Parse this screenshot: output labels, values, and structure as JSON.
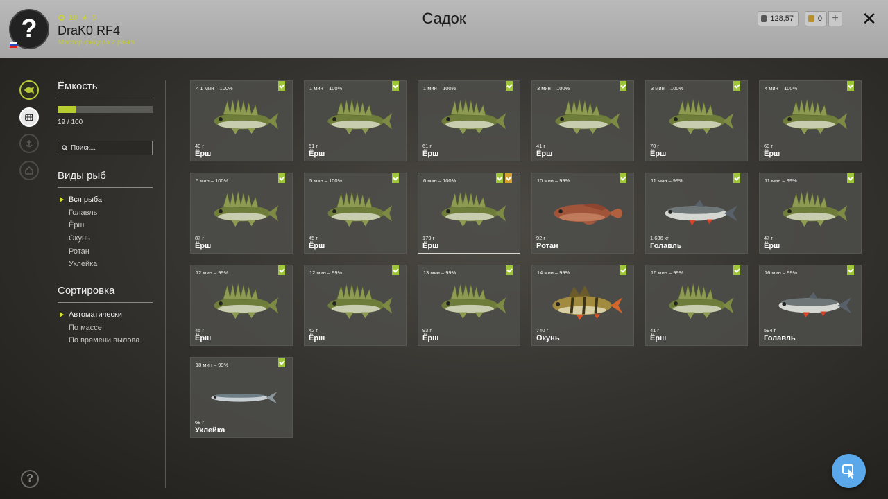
{
  "player": {
    "avatar_glyph": "?",
    "level": "18",
    "stars": "5",
    "name": "DraK0 RF4",
    "rank": "Мастер фидера 2 ранга"
  },
  "title": "Садок",
  "currency": {
    "silver": "128,57",
    "gold": "0"
  },
  "plus_label": "+",
  "close_label": "✕",
  "capacity": {
    "heading": "Ёмкость",
    "used": 19,
    "max": 100,
    "text": "19 / 100"
  },
  "search": {
    "placeholder": "Поиск..."
  },
  "species": {
    "heading": "Виды рыб",
    "items": [
      "Вся рыба",
      "Голавль",
      "Ёрш",
      "Окунь",
      "Ротан",
      "Уклейка"
    ]
  },
  "sort": {
    "heading": "Сортировка",
    "items": [
      "Автоматически",
      "По массе",
      "По времени вылова"
    ]
  },
  "cards": [
    {
      "time": "< 1 мин – 100%",
      "weight": "40 г",
      "name": "Ёрш",
      "fish": "ruffe",
      "gold": false
    },
    {
      "time": "1 мин – 100%",
      "weight": "51 г",
      "name": "Ёрш",
      "fish": "ruffe",
      "gold": false
    },
    {
      "time": "1 мин – 100%",
      "weight": "61 г",
      "name": "Ёрш",
      "fish": "ruffe",
      "gold": false
    },
    {
      "time": "3 мин – 100%",
      "weight": "41 г",
      "name": "Ёрш",
      "fish": "ruffe",
      "gold": false
    },
    {
      "time": "3 мин – 100%",
      "weight": "70 г",
      "name": "Ёрш",
      "fish": "ruffe",
      "gold": false
    },
    {
      "time": "4 мин – 100%",
      "weight": "60 г",
      "name": "Ёрш",
      "fish": "ruffe",
      "gold": false
    },
    {
      "time": "5 мин – 100%",
      "weight": "87 г",
      "name": "Ёрш",
      "fish": "ruffe",
      "gold": false
    },
    {
      "time": "5 мин – 100%",
      "weight": "45 г",
      "name": "Ёрш",
      "fish": "ruffe",
      "gold": false
    },
    {
      "time": "6 мин – 100%",
      "weight": "179 г",
      "name": "Ёрш",
      "fish": "ruffe",
      "gold": true,
      "selected": true
    },
    {
      "time": "10 мин – 99%",
      "weight": "92 г",
      "name": "Ротан",
      "fish": "rotan",
      "gold": false
    },
    {
      "time": "11 мин – 99%",
      "weight": "1,636 кг",
      "name": "Голавль",
      "fish": "chub",
      "gold": false
    },
    {
      "time": "11 мин – 99%",
      "weight": "47 г",
      "name": "Ёрш",
      "fish": "ruffe",
      "gold": false
    },
    {
      "time": "12 мин – 99%",
      "weight": "45 г",
      "name": "Ёрш",
      "fish": "ruffe",
      "gold": false
    },
    {
      "time": "12 мин – 99%",
      "weight": "42 г",
      "name": "Ёрш",
      "fish": "ruffe",
      "gold": false
    },
    {
      "time": "13 мин – 99%",
      "weight": "93 г",
      "name": "Ёрш",
      "fish": "ruffe",
      "gold": false
    },
    {
      "time": "14 мин – 99%",
      "weight": "740 г",
      "name": "Окунь",
      "fish": "perch",
      "gold": false
    },
    {
      "time": "16 мин – 99%",
      "weight": "41 г",
      "name": "Ёрш",
      "fish": "ruffe",
      "gold": false
    },
    {
      "time": "16 мин – 99%",
      "weight": "594 г",
      "name": "Голавль",
      "fish": "chub",
      "gold": false
    },
    {
      "time": "18 мин – 99%",
      "weight": "68 г",
      "name": "Уклейка",
      "fish": "bleak",
      "gold": false
    }
  ],
  "help_glyph": "?",
  "colors": {
    "accent": "#b6cc2f",
    "tag_green": "#9fc63a",
    "tag_gold": "#d6a22a",
    "fab": "#5aa7ea"
  }
}
